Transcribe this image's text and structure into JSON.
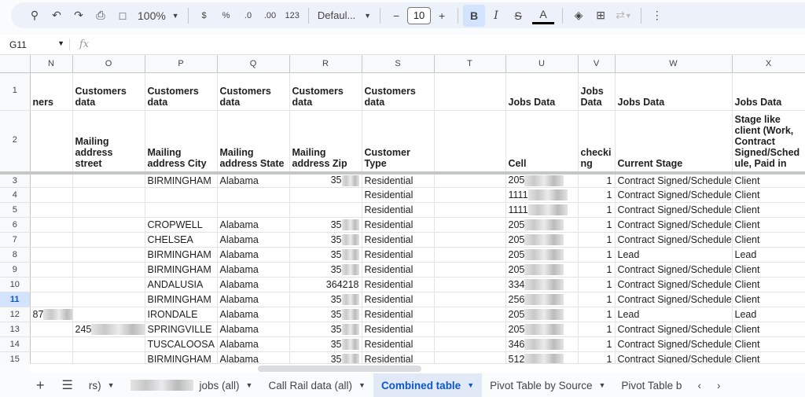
{
  "toolbar": {
    "zoom": "100%",
    "currency": "$",
    "percent": "%",
    "dec_decrease": ".0",
    "dec_increase": ".00",
    "more_formats": "123",
    "font": "Defaul...",
    "font_size": "10",
    "bold": "B",
    "italic": "I",
    "text_color": "A"
  },
  "formula_bar": {
    "cell_ref": "G11",
    "fx": "fx"
  },
  "columns": [
    "N",
    "O",
    "P",
    "Q",
    "R",
    "S",
    "T",
    "U",
    "V",
    "W",
    "X"
  ],
  "header_row1": [
    "ners",
    "Customers data",
    "Customers data",
    "Customers data",
    "Customers data",
    "Customers data",
    "",
    "Jobs Data",
    "Jobs Data",
    "Jobs Data",
    "Jobs Data"
  ],
  "header_row2": [
    "",
    "Mailing address street",
    "Mailing address City",
    "Mailing address State",
    "Mailing address Zip",
    "Customer Type",
    "",
    "Cell",
    "checki ng",
    "Current Stage",
    "Stage like client (Work, Contract Signed/Sched ule, Paid in"
  ],
  "rows": [
    {
      "n": "3",
      "N": "",
      "O": "",
      "P": "BIRMINGHAM",
      "Q": "Alabama",
      "R": "35",
      "S": "Residential",
      "U": "205",
      "V": "1",
      "W": "Contract Signed/Schedule",
      "X": "Client"
    },
    {
      "n": "4",
      "N": "",
      "O": "",
      "P": "",
      "Q": "",
      "R": "",
      "S": "Residential",
      "U": "1111",
      "V": "1",
      "W": "Contract Signed/Schedule",
      "X": "Client"
    },
    {
      "n": "5",
      "N": "",
      "O": "",
      "P": "",
      "Q": "",
      "R": "",
      "S": "Residential",
      "U": "1111",
      "V": "1",
      "W": "Contract Signed/Schedule",
      "X": "Client"
    },
    {
      "n": "6",
      "N": "",
      "O": "",
      "P": "CROPWELL",
      "Q": "Alabama",
      "R": "35",
      "S": "Residential",
      "U": "205",
      "V": "1",
      "W": "Contract Signed/Schedule",
      "X": "Client"
    },
    {
      "n": "7",
      "N": "",
      "O": "",
      "P": "CHELSEA",
      "Q": "Alabama",
      "R": "35",
      "S": "Residential",
      "U": "205",
      "V": "1",
      "W": "Contract Signed/Schedule",
      "X": "Client"
    },
    {
      "n": "8",
      "N": "",
      "O": "",
      "P": "BIRMINGHAM",
      "Q": "Alabama",
      "R": "35",
      "S": "Residential",
      "U": "205",
      "V": "1",
      "W": "Lead",
      "X": "Lead"
    },
    {
      "n": "9",
      "N": "",
      "O": "",
      "P": "BIRMINGHAM",
      "Q": "Alabama",
      "R": "35",
      "S": "Residential",
      "U": "205",
      "V": "1",
      "W": "Contract Signed/Schedule",
      "X": "Client"
    },
    {
      "n": "10",
      "N": "",
      "O": "",
      "P": "ANDALUSIA",
      "Q": "Alabama",
      "R": "364218",
      "S": "Residential",
      "U": "334",
      "V": "1",
      "W": "Contract Signed/Schedule",
      "X": "Client"
    },
    {
      "n": "11",
      "N": "",
      "O": "",
      "P": "BIRMINGHAM",
      "Q": "Alabama",
      "R": "35",
      "S": "Residential",
      "U": "256",
      "V": "1",
      "W": "Contract Signed/Schedule",
      "X": "Client"
    },
    {
      "n": "12",
      "N": "87",
      "O": "",
      "P": "IRONDALE",
      "Q": "Alabama",
      "R": "35",
      "S": "Residential",
      "U": "205",
      "V": "1",
      "W": "Lead",
      "X": "Lead"
    },
    {
      "n": "13",
      "N": "",
      "O": "245",
      "P": "SPRINGVILLE",
      "Q": "Alabama",
      "R": "35",
      "S": "Residential",
      "U": "205",
      "V": "1",
      "W": "Contract Signed/Schedule",
      "X": "Client"
    },
    {
      "n": "14",
      "N": "",
      "O": "",
      "P": "TUSCALOOSA",
      "Q": "Alabama",
      "R": "35",
      "S": "Residential",
      "U": "346",
      "V": "1",
      "W": "Contract Signed/Schedule",
      "X": "Client"
    },
    {
      "n": "15",
      "N": "",
      "O": "",
      "P": "BIRMINGHAM",
      "Q": "Alabama",
      "R": "35",
      "S": "Residential",
      "U": "512",
      "V": "1",
      "W": "Contract Signed/Schedule",
      "X": "Client"
    }
  ],
  "selected_row": "11",
  "sheet_tabs": [
    {
      "label": "rs)",
      "active": false
    },
    {
      "label": "jobs (all)",
      "active": false
    },
    {
      "label": "Call Rail data (all)",
      "active": false
    },
    {
      "label": "Combined table",
      "active": true
    },
    {
      "label": "Pivot Table by Source",
      "active": false
    },
    {
      "label": "Pivot Table b",
      "active": false
    }
  ]
}
